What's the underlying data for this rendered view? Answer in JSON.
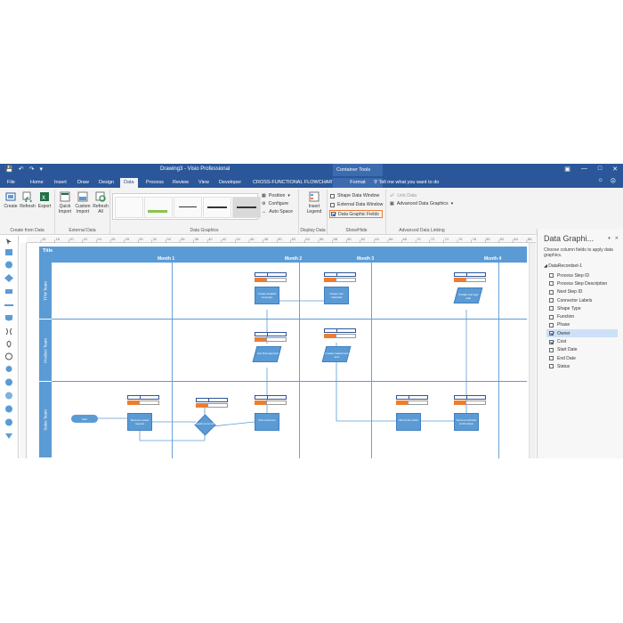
{
  "window": {
    "title": "Drawing3 - Visio Professional",
    "context_group": "Container Tools",
    "tell_me": "Tell me what you want to do"
  },
  "tabs": [
    "File",
    "Home",
    "Insert",
    "Draw",
    "Design",
    "Data",
    "Process",
    "Review",
    "View",
    "Developer",
    "CROSS-FUNCTIONAL FLOWCHART",
    "Format"
  ],
  "active_tab": "Data",
  "ribbon": {
    "create_from_data": {
      "create": "Create",
      "refresh": "Refresh",
      "export": "Export",
      "label": "Create from Data"
    },
    "external_data": {
      "quick_import": "Quick Import",
      "custom_import": "Custom Import",
      "refresh_all": "Refresh All",
      "label": "External Data"
    },
    "data_graphics": {
      "position": "Position",
      "configure": "Configure",
      "auto_space": "Auto Space",
      "label": "Data Graphics"
    },
    "display_data": {
      "insert_legend": "Insert Legend",
      "label": "Display Data"
    },
    "show_hide": {
      "shape_data_window": "Shape Data Window",
      "external_data_window": "External Data Window",
      "data_graphic_fields": "Data Graphic Fields",
      "label": "Show/Hide"
    },
    "advanced_linking": {
      "link_data": "Link Data",
      "advanced_data_graphics": "Advanced Data Graphics",
      "label": "Advanced Data Linking"
    }
  },
  "ruler_ticks": [
    "16",
    "18",
    "20",
    "22",
    "24",
    "26",
    "28",
    "30",
    "32",
    "34",
    "36",
    "38",
    "40",
    "42",
    "44",
    "46",
    "48",
    "50",
    "52",
    "54",
    "56",
    "58",
    "60",
    "62",
    "64",
    "66",
    "68",
    "70",
    "72",
    "74",
    "76",
    "78",
    "80",
    "82",
    "84",
    "86"
  ],
  "flowchart": {
    "title": "Title",
    "phases": [
      "Month 1",
      "Month 2",
      "Month 3",
      "Month 4"
    ],
    "lanes": [
      "TPM Team",
      "Product Team",
      "Sales Team"
    ],
    "shapes": {
      "start": "Start",
      "receive_review": "Receive review request",
      "needs_more": "Needs more info?",
      "create_summary": "Create detailed summary",
      "assign_materials": "Assign new materials",
      "publish_plan": "Publish and sign plan",
      "final_approval": "Get final approval",
      "create_resources": "Create created and sent",
      "sub_resources": "Sub resources",
      "fill_out_sheet": "Fill out the sheet",
      "send_emails": "Send out all links confirmation"
    }
  },
  "data_panel": {
    "title": "Data Graphi...",
    "description": "Choose column fields to apply data graphics.",
    "record": "DataRecordset-1",
    "fields": [
      {
        "label": "Process Step ID",
        "checked": false
      },
      {
        "label": "Process Step Description",
        "checked": false
      },
      {
        "label": "Next Step ID",
        "checked": false
      },
      {
        "label": "Connector Labels",
        "checked": false
      },
      {
        "label": "Shape Type",
        "checked": false
      },
      {
        "label": "Function",
        "checked": false
      },
      {
        "label": "Phase",
        "checked": false
      },
      {
        "label": "Owner",
        "checked": true
      },
      {
        "label": "Cost",
        "checked": true
      },
      {
        "label": "Start Date",
        "checked": false
      },
      {
        "label": "End Date",
        "checked": false
      },
      {
        "label": "Status",
        "checked": false
      }
    ]
  }
}
